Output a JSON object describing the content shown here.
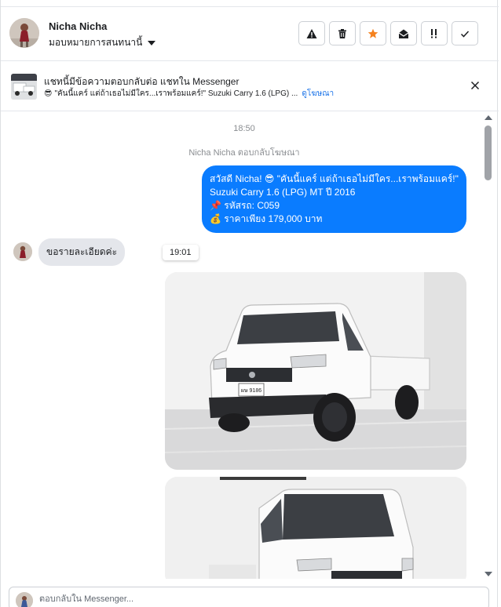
{
  "header": {
    "contact_name": "Nicha Nicha",
    "assign_label": "มอบหมายการสนทนานี้",
    "toolbar": [
      {
        "name": "mark-spam-button",
        "icon": "warning-icon"
      },
      {
        "name": "delete-button",
        "icon": "trash-icon"
      },
      {
        "name": "star-button",
        "icon": "star-icon",
        "color": "#f5821f"
      },
      {
        "name": "mark-unread-button",
        "icon": "envelope-open-icon"
      },
      {
        "name": "follow-up-button",
        "icon": "exclamation-icon"
      },
      {
        "name": "mark-done-button",
        "icon": "check-icon"
      }
    ]
  },
  "ad_banner": {
    "title": "แชทนี้มีข้อความตอบกลับต่อ แชทใน Messenger",
    "emoji": "😎",
    "snippet": "\"คันนี้แคร์ แต่ถ้าเธอไม่มีใคร...เราพร้อมแคร์!\" Suzuki Carry 1.6 (LPG) ...",
    "link_label": "ดูโฆษณา"
  },
  "chat": {
    "timestamp_1": "18:50",
    "reply_note": "Nicha Nicha ตอบกลับโฆษณา",
    "outgoing_lines": [
      "สวัสดี Nicha! 😎 \"คันนี้แคร์ แต่ถ้าเธอไม่มีใคร...เราพร้อมแคร์!\"",
      "Suzuki Carry 1.6 (LPG) MT ปี 2016",
      "📌 รหัสรถ: C059",
      "💰 ราคาเพียง 179,000 บาท"
    ],
    "incoming_text": "ขอรายละเอียดค่ะ",
    "timestamp_2": "19:01",
    "plate_text": "ผษ 9186"
  },
  "composer": {
    "placeholder": "ตอบกลับใน Messenger..."
  },
  "colors": {
    "outgoing_bubble": "#0a7cff",
    "incoming_bubble": "#e4e6eb",
    "link": "#1a73e8",
    "star": "#f5821f"
  }
}
